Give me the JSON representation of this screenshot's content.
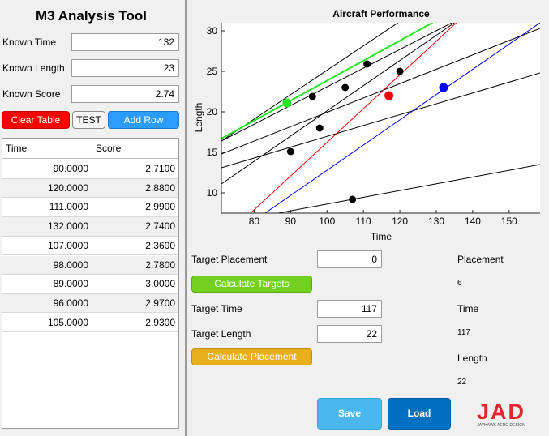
{
  "app_title": "M3 Analysis Tool",
  "inputs": {
    "known_time": {
      "label": "Known Time",
      "value": "132"
    },
    "known_length": {
      "label": "Known Length",
      "value": "23"
    },
    "known_score": {
      "label": "Known Score",
      "value": "2.74"
    }
  },
  "buttons": {
    "clear_table": "Clear Table",
    "test": "TEST",
    "add_row": "Add Row",
    "calculate_targets": "Calculate Targets",
    "calculate_placement": "Calculate Placement",
    "save": "Save",
    "load": "Load"
  },
  "table": {
    "columns": [
      "Time",
      "Score"
    ],
    "rows": [
      [
        "90.0000",
        "2.7100"
      ],
      [
        "120.0000",
        "2.8800"
      ],
      [
        "111.0000",
        "2.9900"
      ],
      [
        "132.0000",
        "2.7400"
      ],
      [
        "107.0000",
        "2.3600"
      ],
      [
        "98.0000",
        "2.7800"
      ],
      [
        "89.0000",
        "3.0000"
      ],
      [
        "96.0000",
        "2.9700"
      ],
      [
        "105.0000",
        "2.9300"
      ]
    ]
  },
  "targets": {
    "placement": {
      "label": "Target Placement",
      "value": "0"
    },
    "time": {
      "label": "Target Time",
      "value": "117"
    },
    "length": {
      "label": "Target Length",
      "value": "22"
    }
  },
  "results": {
    "placement_label": "Placement",
    "placement_value": "6",
    "time_label": "Time",
    "time_value": "117",
    "length_label": "Length",
    "length_value": "22"
  },
  "logo": {
    "text": "JAD",
    "subtitle": "JAYHAWK AERO DESIGN"
  },
  "chart_data": {
    "type": "scatter",
    "title": "Aircraft Performance",
    "xlabel": "Time",
    "ylabel": "Length",
    "xlim": [
      71,
      158.5
    ],
    "ylim": [
      7.5,
      31
    ],
    "xticks": [
      80,
      90,
      100,
      110,
      120,
      130,
      140,
      150
    ],
    "yticks": [
      10,
      15,
      20,
      25,
      30
    ],
    "grid": false,
    "black_points": [
      {
        "x": 90,
        "y": 15.1
      },
      {
        "x": 96,
        "y": 21.9
      },
      {
        "x": 98,
        "y": 18.0
      },
      {
        "x": 105,
        "y": 23.0
      },
      {
        "x": 107,
        "y": 9.2
      },
      {
        "x": 111,
        "y": 25.9
      },
      {
        "x": 120,
        "y": 25.0
      }
    ],
    "black_lines": [
      {
        "x0": 71,
        "y0": 6.2,
        "x1": 158.5,
        "y1": 13.5
      },
      {
        "x0": 71,
        "y0": 13.1,
        "x1": 158.5,
        "y1": 24.8
      },
      {
        "x0": 71,
        "y0": 11.1,
        "x1": 135,
        "y1": 31
      },
      {
        "x0": 71,
        "y0": 14.8,
        "x1": 158.5,
        "y1": 30.3
      },
      {
        "x0": 71,
        "y0": 16.4,
        "x1": 134.3,
        "y1": 31
      },
      {
        "x0": 71,
        "y0": 16.4,
        "x1": 119.5,
        "y1": 31
      }
    ],
    "green_point": {
      "x": 89,
      "y": 21.1
    },
    "green_line": {
      "x0": 71,
      "y0": 16.7,
      "x1": 129,
      "y1": 31
    },
    "red_point": {
      "x": 117,
      "y": 22.0
    },
    "red_line": {
      "x0": 79,
      "y0": 7.5,
      "x1": 135.5,
      "y1": 31
    },
    "blue_point": {
      "x": 132,
      "y": 23.0
    },
    "blue_line": {
      "x0": 83,
      "y0": 7.5,
      "x1": 158.5,
      "y1": 31
    },
    "colors": {
      "black": "#000000",
      "green": "#23e823",
      "red": "#ff0000",
      "blue": "#0000ff"
    }
  }
}
